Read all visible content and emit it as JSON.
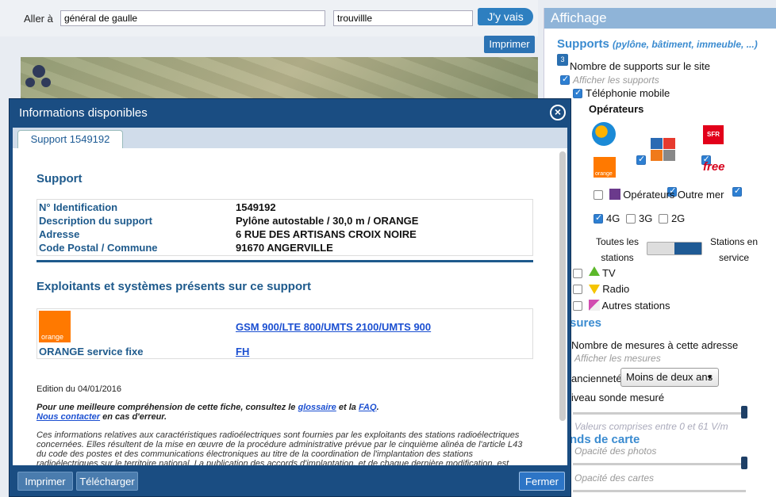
{
  "search": {
    "goto_label": "Aller à",
    "address_value": "général de gaulle",
    "city_value": "trouvillle",
    "go_label": "J'y vais",
    "print_label": "Imprimer"
  },
  "panel": {
    "title": "Affichage",
    "supports_title": "Supports",
    "supports_subtitle": "(pylône, bâtiment, immeuble, ...)",
    "badge_count": "3",
    "supports_count_label": "Nombre de supports sur le site",
    "show_supports_label": "Afficher les supports",
    "mobile_label": "Téléphonie mobile",
    "operators_label": "Opérateurs",
    "sfr_label": "SFR",
    "orange_label": "orange",
    "free_label": "free",
    "outremer_label": "Opérateurs Outre mer",
    "tech": [
      "4G",
      "3G",
      "2G"
    ],
    "all_stations_label": "Toutes les stations",
    "in_service_label": "Stations en service",
    "tv_label": "TV",
    "radio_label": "Radio",
    "other_label": "Autres stations",
    "mesures_title": "sures",
    "mesures_count_label": "Nombre de mesures à cette adresse",
    "show_mesures_label": "Afficher les mesures",
    "age_label": "ancienneté",
    "age_value": "Moins de deux ans",
    "level_label": "iveau sonde mesuré",
    "values_range": "Valeurs comprises entre 0 et 61 V/m",
    "map_bg_title": "nds de carte",
    "photo_opacity_label": "Opacité des photos",
    "map_opacity_label": "Opacité des cartes"
  },
  "modal": {
    "title": "Informations disponibles",
    "tab_label": "Support 1549192",
    "support_title": "Support",
    "rows": [
      {
        "k": "N° Identification",
        "v": "1549192"
      },
      {
        "k": "Description du support",
        "v": "Pylône autostable / 30,0 m / ORANGE"
      },
      {
        "k": "Adresse",
        "v": "6 RUE DES ARTISANS CROIX NOIRE"
      },
      {
        "k": "Code Postal / Commune",
        "v": "91670 ANGERVILLE"
      }
    ],
    "exploitants_title": "Exploitants et systèmes présents sur ce support",
    "orange_logo_text": "orange",
    "systems_link": "GSM 900/LTE 800/UMTS 2100/UMTS 900",
    "fixed_label": "ORANGE service fixe",
    "fixed_link": "FH",
    "edition": "Edition du 04/01/2016",
    "help_prefix": "Pour une meilleure compréhension de cette fiche, consultez le",
    "glossary": "glossaire",
    "and": "et la",
    "faq": "FAQ",
    "contact": "Nous contacter",
    "contact_suffix": "en cas d'erreur.",
    "disclaimer": "Ces informations relatives aux caractéristiques radioélectriques sont fournies par les exploitants des stations radioélectriques concernées. Elles résultent de la mise en œuvre de la procédure administrative prévue par le cinquième alinéa de l'article L43 du code des postes et des communications électroniques au titre de la coordination de l'implantation des stations radioélectriques sur le territoire national. La publication des accords d'implantation, et de chaque dernière modification, est assurée par la mise en ligne",
    "print_btn": "Imprimer",
    "download_btn": "Télécharger",
    "close_btn": "Fermer"
  }
}
